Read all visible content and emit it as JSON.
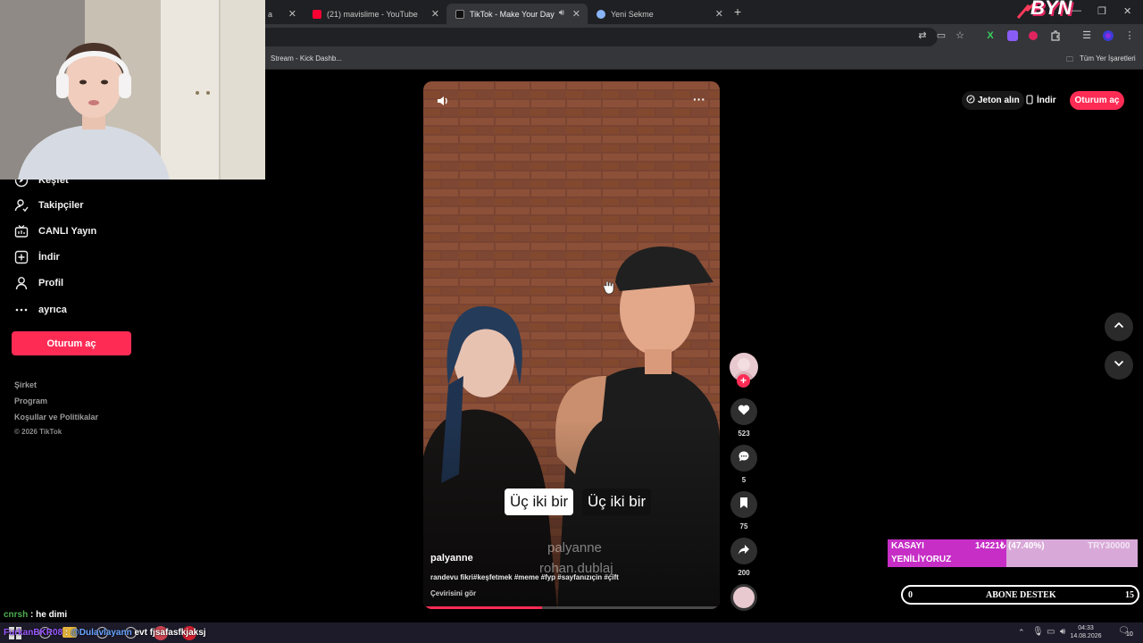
{
  "browser": {
    "tabs": [
      {
        "label": "a",
        "favicon_color": "#5a5a5a"
      },
      {
        "label": "(21) mavislime - YouTube",
        "favicon_color": "#ff0033"
      },
      {
        "label": "TikTok - Make Your Day",
        "favicon_color": "#111111"
      },
      {
        "label": "Yeni Sekme",
        "favicon_color": "#8ab4f8"
      }
    ],
    "close_glyph": "✕",
    "new_tab_glyph": "+",
    "bookmarks": {
      "item": "Stream - Kick Dashb...",
      "all_bookmarks": "Tüm Yer İşaretleri"
    }
  },
  "sidebar": {
    "items": [
      {
        "label": "Keşfet",
        "icon": "compass-icon"
      },
      {
        "label": "Takipçiler",
        "icon": "user-follow-icon"
      },
      {
        "label": "CANLI Yayın",
        "icon": "live-tv-icon"
      },
      {
        "label": "İndir",
        "icon": "plus-square-icon"
      },
      {
        "label": "Profil",
        "icon": "person-icon"
      },
      {
        "label": "ayrıca",
        "icon": "more-icon"
      }
    ],
    "login_button": "Oturum aç",
    "footer_links": [
      "Şirket",
      "Program",
      "Koşullar ve Politikalar"
    ],
    "copyright": "© 2026 TikTok"
  },
  "header": {
    "coins": "Jeton alın",
    "download": "İndir",
    "login": "Oturum aç"
  },
  "video": {
    "caption_left": "Üç iki bir",
    "caption_right": "Üç iki bir",
    "watermark_user": "palyanne",
    "watermark_dub": "rohan.dublaj",
    "username": "palyanne",
    "description": "randevu fikri#keşfetmek #meme #fyp #sayfanızıçin #çift",
    "translate": "Çevirisini gör",
    "progress": 0.4
  },
  "actions": {
    "likes": "523",
    "comments": "5",
    "saves": "75",
    "shares": "200"
  },
  "stream_overlay": {
    "donation_line1": "KASAYI",
    "donation_line2": "YENİLİYORUZ",
    "donation_amount": "14221₺ (47.40%)",
    "donation_goal": "TRY30000",
    "donation_progress": 0.474,
    "sub_left": "0",
    "sub_label": "ABONE DESTEK",
    "sub_right": "15",
    "logo_text": "BYN"
  },
  "chat": [
    {
      "user": "cnrsh",
      "sep": " : ",
      "text": "he dimi",
      "user_color": "#4caf50"
    },
    {
      "user": "FurkanBKR08",
      "sep": " : ",
      "mention": "@Dulavlayann",
      "text": " evt fjsafasfkjaksj",
      "user_color": "#9b59ff",
      "mention_color": "#6aa4ff"
    }
  ],
  "taskbar": {
    "time": "04:33",
    "date": "14.08.2026",
    "notifications": "10"
  },
  "colors": {
    "accent": "#fe2c55",
    "chrome_bg": "#35363a",
    "tab_bg": "#1f2023"
  }
}
